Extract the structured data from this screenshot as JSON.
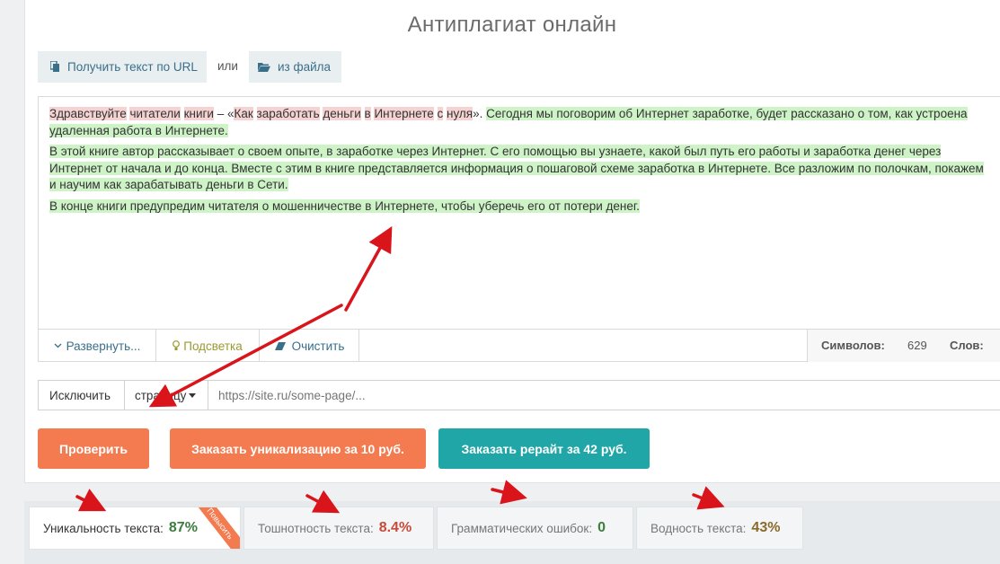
{
  "app": {
    "title": "Антиплагиат онлайн"
  },
  "source": {
    "url_button": "Получить текст по URL",
    "or_label": "или",
    "file_button": "из файла"
  },
  "editor": {
    "paragraph1_segments": [
      {
        "text": "Здравствуйте",
        "hl": "r"
      },
      {
        "text": " ",
        "hl": ""
      },
      {
        "text": "читатели",
        "hl": "r"
      },
      {
        "text": " ",
        "hl": ""
      },
      {
        "text": "книги",
        "hl": "r"
      },
      {
        "text": " – «",
        "hl": ""
      },
      {
        "text": "Как",
        "hl": "r"
      },
      {
        "text": " ",
        "hl": ""
      },
      {
        "text": "заработать",
        "hl": "r"
      },
      {
        "text": " ",
        "hl": ""
      },
      {
        "text": "деньги",
        "hl": "r"
      },
      {
        "text": " ",
        "hl": ""
      },
      {
        "text": "в",
        "hl": "r"
      },
      {
        "text": " ",
        "hl": ""
      },
      {
        "text": "Интернете",
        "hl": "r"
      },
      {
        "text": " ",
        "hl": ""
      },
      {
        "text": "с",
        "hl": "r"
      },
      {
        "text": " ",
        "hl": ""
      },
      {
        "text": "нуля",
        "hl": "r"
      },
      {
        "text": "». ",
        "hl": ""
      },
      {
        "text": "Сегодня мы поговорим об Интернет заработке, будет рассказано о том, как устроена удаленная работа в Интернете.",
        "hl": "g"
      }
    ],
    "paragraph2": "В этой книге автор рассказывает о своем опыте, в заработке через Интернет. С его помощью вы узнаете, какой был путь его работы и заработка денег через Интернет от начала и до конца. Вместе с этим в книге представляется информация о пошаговой схеме заработка в Интернете. Все разложим по полочкам, покажем и научим как зарабатывать деньги в Сети.",
    "paragraph3": "В конце книги предупредим читателя о мошенничестве в Интернете, чтобы уберечь его от потери денег."
  },
  "toolbar": {
    "expand_label": "Развернуть...",
    "highlight_label": "Подсветка",
    "clear_label": "Очистить",
    "chars_label": "Символов:",
    "chars_value": "629",
    "words_label": "Слов:"
  },
  "exclude": {
    "label": "Исключить",
    "dropdown_value": "страницу",
    "url_placeholder": "https://site.ru/some-page/..."
  },
  "actions": {
    "check_label": "Проверить",
    "order_uniq_label": "Заказать уникализацию за 10 руб.",
    "order_rewrite_label": "Заказать рерайт за 42 руб."
  },
  "results": {
    "tabs": [
      {
        "label": "Уникальность текста:",
        "value": "87%",
        "color": "#3d7d3d",
        "ribbon": "Повысить"
      },
      {
        "label": "Тошнотность текста:",
        "value": "8.4%",
        "color": "#c94a3a"
      },
      {
        "label": "Грамматических ошибок:",
        "value": "0",
        "color": "#3d7d3d"
      },
      {
        "label": "Водность текста:",
        "value": "43%",
        "color": "#8a6a2a"
      }
    ]
  },
  "colors": {
    "check_button": "#f47b50",
    "rewrite_button": "#21a6a8",
    "arrow": "#d9141b",
    "highlight_green": "#cdf3c7",
    "highlight_red": "#f6d3d3"
  }
}
